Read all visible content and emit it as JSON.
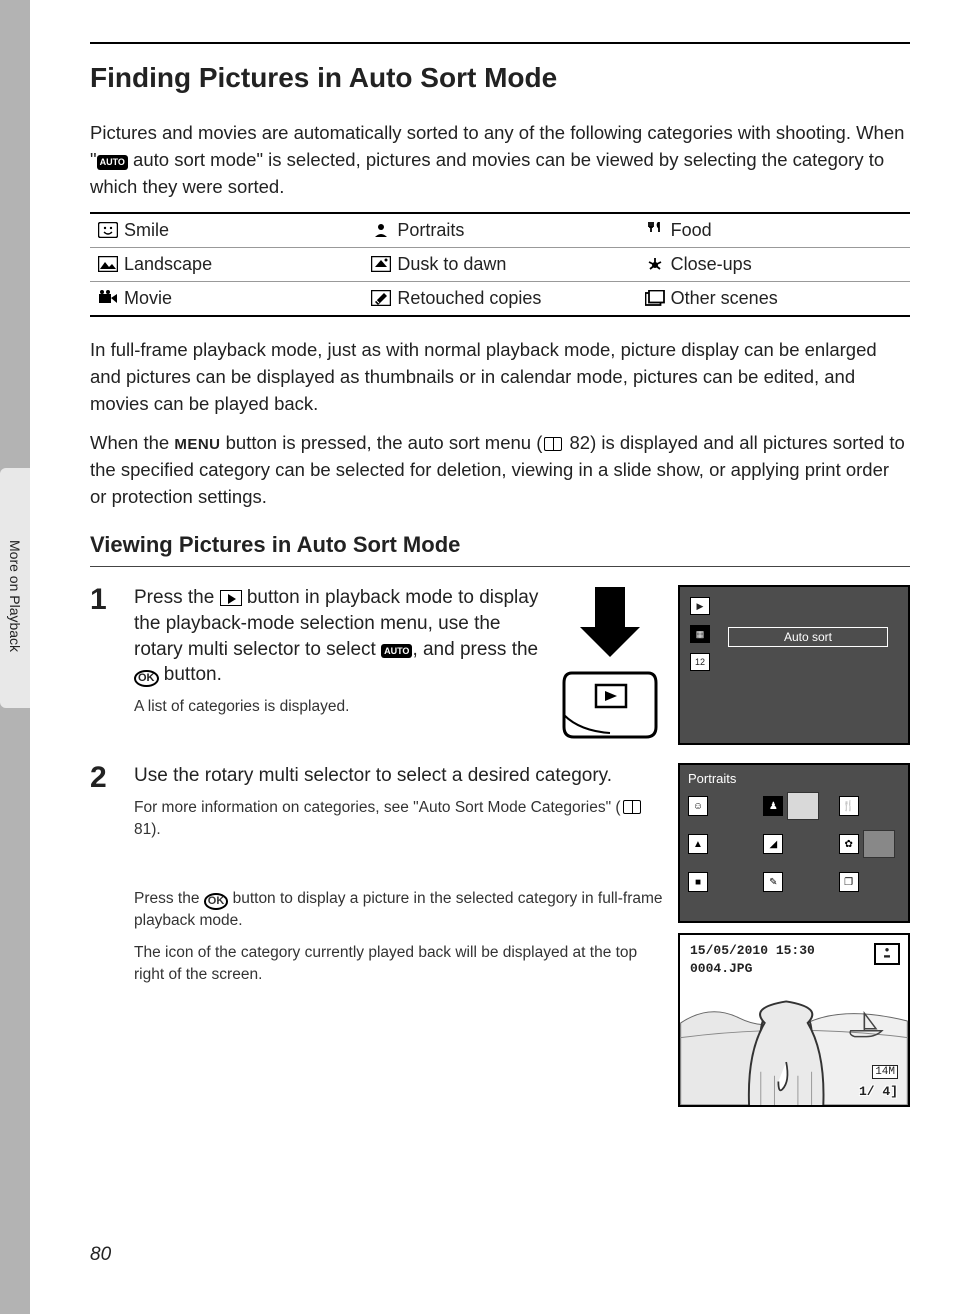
{
  "side_label": "More on Playback",
  "h1": "Finding Pictures in Auto Sort Mode",
  "intro_a": "Pictures and movies are automatically sorted to any of the following categories with shooting. When \"",
  "intro_b": " auto sort mode\" is selected, pictures and movies can be viewed by selecting the category to which they were sorted.",
  "categories": [
    [
      "Smile",
      "Portraits",
      "Food"
    ],
    [
      "Landscape",
      "Dusk to dawn",
      "Close-ups"
    ],
    [
      "Movie",
      "Retouched copies",
      "Other scenes"
    ]
  ],
  "para2": "In full-frame playback mode, just as with normal playback mode, picture display can be enlarged and pictures can be displayed as thumbnails or in calendar mode, pictures can be edited, and movies can be played back.",
  "para3_a": "When the ",
  "menu_word": "MENU",
  "para3_b": " button is pressed, the auto sort menu (",
  "para3_ref": "82",
  "para3_c": ") is displayed and all pictures sorted to the specified category can be selected for deletion, viewing in a slide show, or applying print order or protection settings.",
  "h2": "Viewing Pictures in Auto Sort Mode",
  "step1": {
    "num": "1",
    "text_a": "Press the ",
    "text_b": " button in playback mode to display the playback-mode selection menu, use the rotary multi selector to select ",
    "text_c": ", and press the ",
    "ok": "OK",
    "text_d": " button.",
    "sub": "A list of categories is displayed.",
    "screen_label": "Auto sort"
  },
  "step2": {
    "num": "2",
    "head": "Use the rotary multi selector to select a desired category.",
    "sub1_a": "For more information on categories, see \"Auto Sort Mode Categories\" (",
    "sub1_ref": "81",
    "sub1_b": ").",
    "sub2_a": "Press the ",
    "ok": "OK",
    "sub2_b": " button to display a picture in the selected category in full-frame playback mode.",
    "sub3": "The icon of the category currently played back will be displayed at the top right of the screen.",
    "screen2_title": "Portraits",
    "screen3": {
      "date": "15/05/2010 15:30",
      "fname": "0004.JPG",
      "counter": "1/    4]",
      "size": "14M"
    }
  },
  "page_num": "80"
}
